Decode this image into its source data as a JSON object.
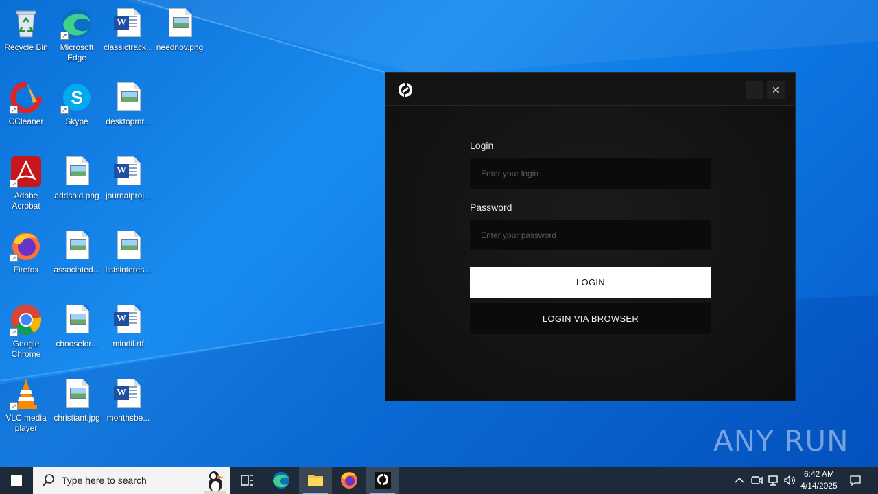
{
  "desktop": {
    "icons": [
      {
        "label": "Recycle Bin",
        "icon": "recycle-bin-icon"
      },
      {
        "label": "Microsoft Edge",
        "icon": "edge-icon"
      },
      {
        "label": "classictrack...",
        "icon": "word-doc-icon"
      },
      {
        "label": "neednov.png",
        "icon": "image-file-icon"
      },
      {
        "label": "CCleaner",
        "icon": "ccleaner-icon"
      },
      {
        "label": "Skype",
        "icon": "skype-icon"
      },
      {
        "label": "desktopmr...",
        "icon": "image-file-icon"
      },
      {
        "label": "Adobe Acrobat",
        "icon": "acrobat-icon"
      },
      {
        "label": "addsaid.png",
        "icon": "image-file-icon"
      },
      {
        "label": "journalproj...",
        "icon": "word-doc-icon"
      },
      {
        "label": "Firefox",
        "icon": "firefox-icon"
      },
      {
        "label": "associated...",
        "icon": "image-file-icon"
      },
      {
        "label": "listsinteres...",
        "icon": "image-file-icon"
      },
      {
        "label": "Google Chrome",
        "icon": "chrome-icon"
      },
      {
        "label": "chooselor...",
        "icon": "image-file-icon"
      },
      {
        "label": "mindil.rtf",
        "icon": "word-doc-icon"
      },
      {
        "label": "VLC media player",
        "icon": "vlc-icon"
      },
      {
        "label": "christiant.jpg",
        "icon": "image-file-icon"
      },
      {
        "label": "monthsbe...",
        "icon": "word-doc-icon"
      }
    ]
  },
  "app_window": {
    "login_label": "Login",
    "login_placeholder": "Enter your login",
    "login_value": "",
    "password_label": "Password",
    "password_placeholder": "Enter your password",
    "password_value": "",
    "login_button": "LOGIN",
    "browser_button": "LOGIN VIA BROWSER",
    "minimize_glyph": "–",
    "close_glyph": "✕"
  },
  "watermark": {
    "text": "ANY RUN"
  },
  "taskbar": {
    "search_placeholder": "Type here to search",
    "time": "6:42 AM",
    "date": "4/14/2025"
  },
  "colors": {
    "desktop_blue": "#0e7be6",
    "window_bg": "#121212",
    "input_bg": "#0b0b0b",
    "button_primary_bg": "#ffffff"
  }
}
